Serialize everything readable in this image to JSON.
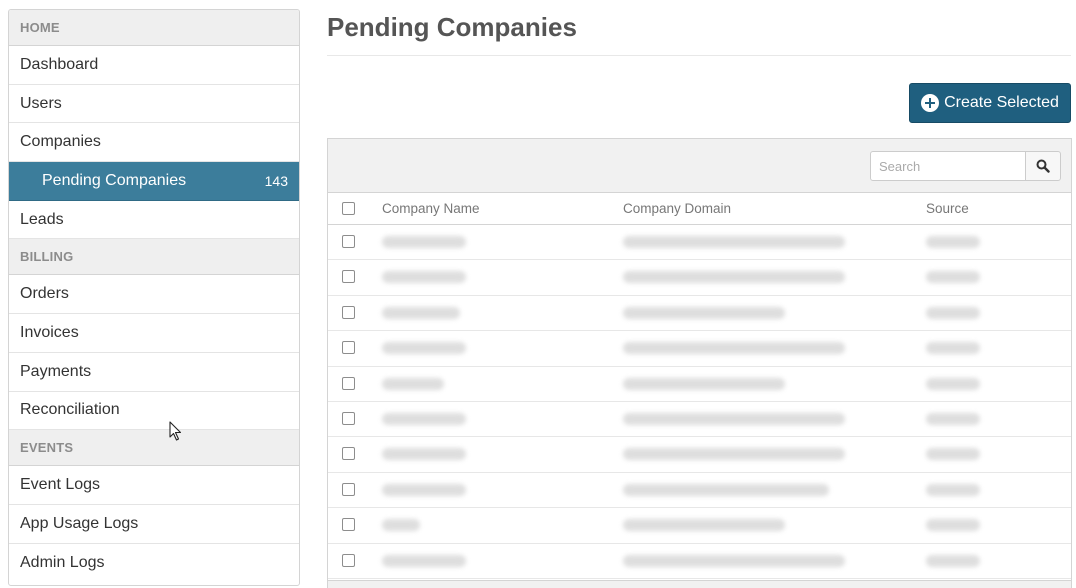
{
  "sidebar": {
    "home_label": "HOME",
    "home_items": [
      {
        "label": "Dashboard"
      },
      {
        "label": "Users"
      },
      {
        "label": "Companies"
      },
      {
        "label": "Pending Companies",
        "count": "143",
        "active": true
      },
      {
        "label": "Leads"
      }
    ],
    "billing_label": "BILLING",
    "billing_items": [
      {
        "label": "Orders"
      },
      {
        "label": "Invoices"
      },
      {
        "label": "Payments"
      },
      {
        "label": "Reconciliation"
      }
    ],
    "events_label": "EVENTS",
    "events_items": [
      {
        "label": "Event Logs"
      },
      {
        "label": "App Usage Logs"
      },
      {
        "label": "Admin Logs"
      }
    ]
  },
  "main": {
    "title": "Pending Companies",
    "create_button_label": "Create Selected",
    "search_placeholder": "Search",
    "columns": [
      "Company Name",
      "Company Domain",
      "Source"
    ],
    "rows": 10
  },
  "colors": {
    "active_item": "#3c7d9b",
    "primary_button": "#1f5f7f"
  }
}
